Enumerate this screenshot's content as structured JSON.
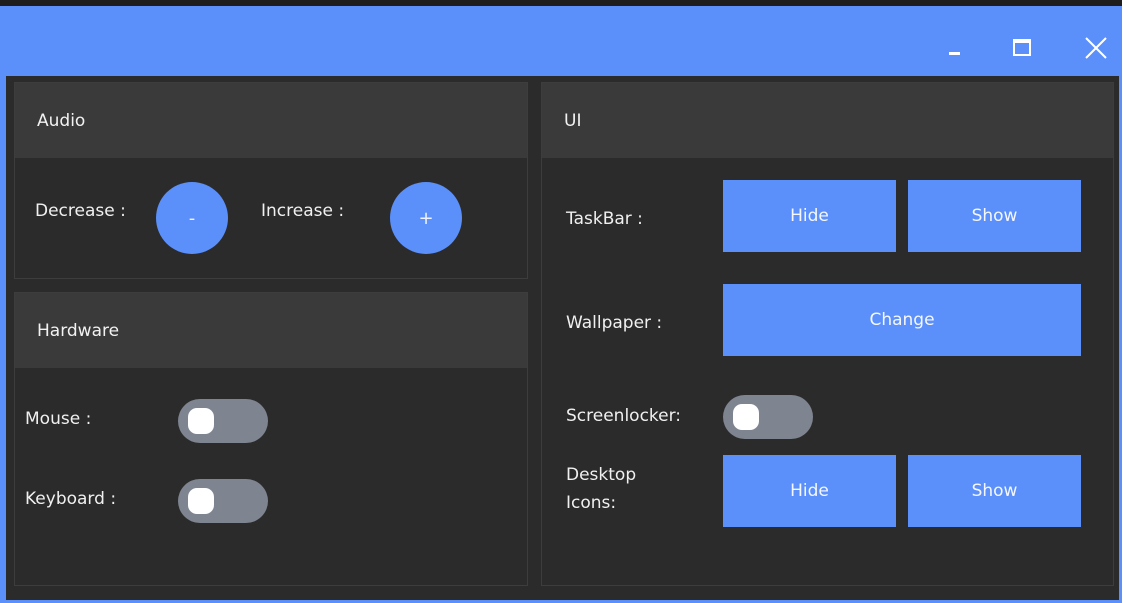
{
  "window": {
    "controls": {
      "minimize_icon": "minimize-icon",
      "maximize_icon": "maximize-icon",
      "close_icon": "close-icon"
    },
    "accent_color": "#5b8ff9"
  },
  "audio": {
    "title": "Audio",
    "decrease_label": "Decrease :",
    "decrease_button": "-",
    "increase_label": "Increase :",
    "increase_button": "+"
  },
  "hardware": {
    "title": "Hardware",
    "mouse_label": "Mouse :",
    "mouse_toggle_on": false,
    "keyboard_label": "Keyboard :",
    "keyboard_toggle_on": false
  },
  "ui": {
    "title": "UI",
    "taskbar_label": "TaskBar :",
    "taskbar_hide": "Hide",
    "taskbar_show": "Show",
    "wallpaper_label": "Wallpaper :",
    "wallpaper_change": "Change",
    "screenlocker_label": "Screenlocker:",
    "screenlocker_toggle_on": false,
    "desktop_icons_label_line1": "Desktop",
    "desktop_icons_label_line2": "Icons:",
    "desktop_icons_hide": "Hide",
    "desktop_icons_show": "Show"
  }
}
